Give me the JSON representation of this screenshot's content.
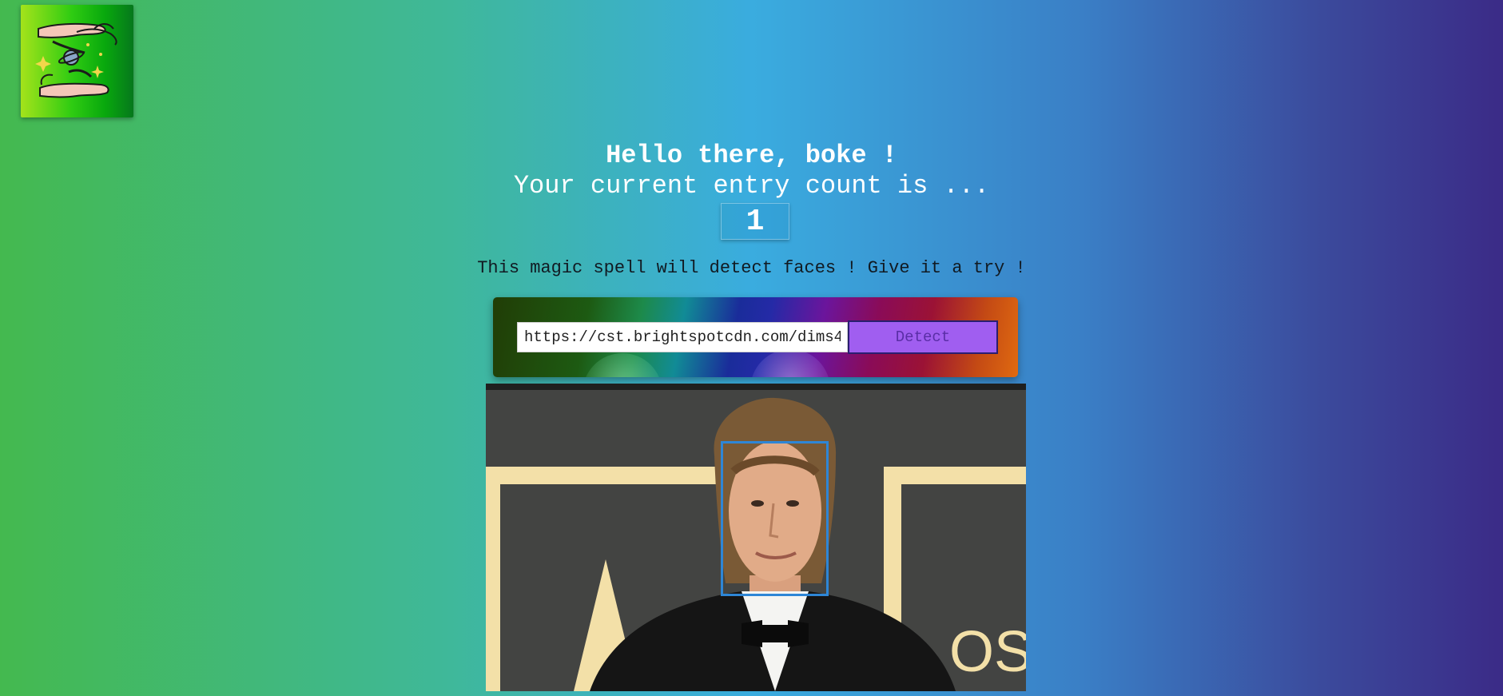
{
  "logo": {
    "icon": "magic-hands-logo-icon"
  },
  "header": {
    "greeting": "Hello there, boke !",
    "entry_text": "Your current entry count is ...",
    "entry_count": "1"
  },
  "instructions": "This magic spell will detect faces ! Give it a try !",
  "form": {
    "url_value": "https://cst.brightspotcdn.com/dims4/",
    "detect_label": "Detect"
  },
  "photo": {
    "sign_text": "OS"
  },
  "colors": {
    "face_box": "#2e86d6",
    "detect_button": "#a05ef0"
  }
}
